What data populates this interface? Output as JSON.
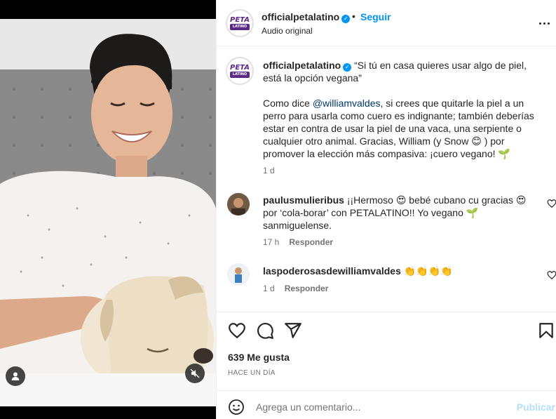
{
  "post": {
    "username": "officialpetalatino",
    "verified_mark": "✓",
    "separator": "•",
    "follow_label": "Seguir",
    "audio_label": "Audio original",
    "avatar_logo": "PETA",
    "avatar_logo_sub": "LATINO"
  },
  "caption": {
    "username": "officialpetalatino",
    "quote": "“Si tú en casa quieres usar algo de piel, está la opción vegana”",
    "body_before_mention": "Como dice ",
    "mention": "@williamvaldes",
    "body_after_mention": ", si crees que quitarle la piel a un perro para usarla como cuero es indignante; también deberías estar en contra de usar la piel de una vaca, una serpiente o cualquier otro animal. Gracias, William (y Snow 😊 ) por promover la elección más compasiva: ¡cuero vegano! 🌱",
    "time": "1 d"
  },
  "comments": [
    {
      "username": "paulusmulieribus",
      "text": "¡¡Hermoso 😍 bebé cubano cu gracias 😍 por ‘cola-borar’ con PETALATINO!! Yo vegano 🌱 sanmiguelense.",
      "time": "17 h",
      "reply_label": "Responder"
    },
    {
      "username": "laspoderosasdewilliamvaldes",
      "text": "👏👏👏👏",
      "time": "1 d",
      "reply_label": "Responder"
    }
  ],
  "actions": {
    "likes": "639 Me gusta",
    "posted": "HACE UN DÍA"
  },
  "add_comment": {
    "placeholder": "Agrega un comentario...",
    "post_label": "Publicar"
  },
  "colors": {
    "accent": "#0095f6",
    "text": "#262626",
    "secondary": "#737373",
    "post_disabled": "#b2dffc",
    "border": "#efefef"
  }
}
